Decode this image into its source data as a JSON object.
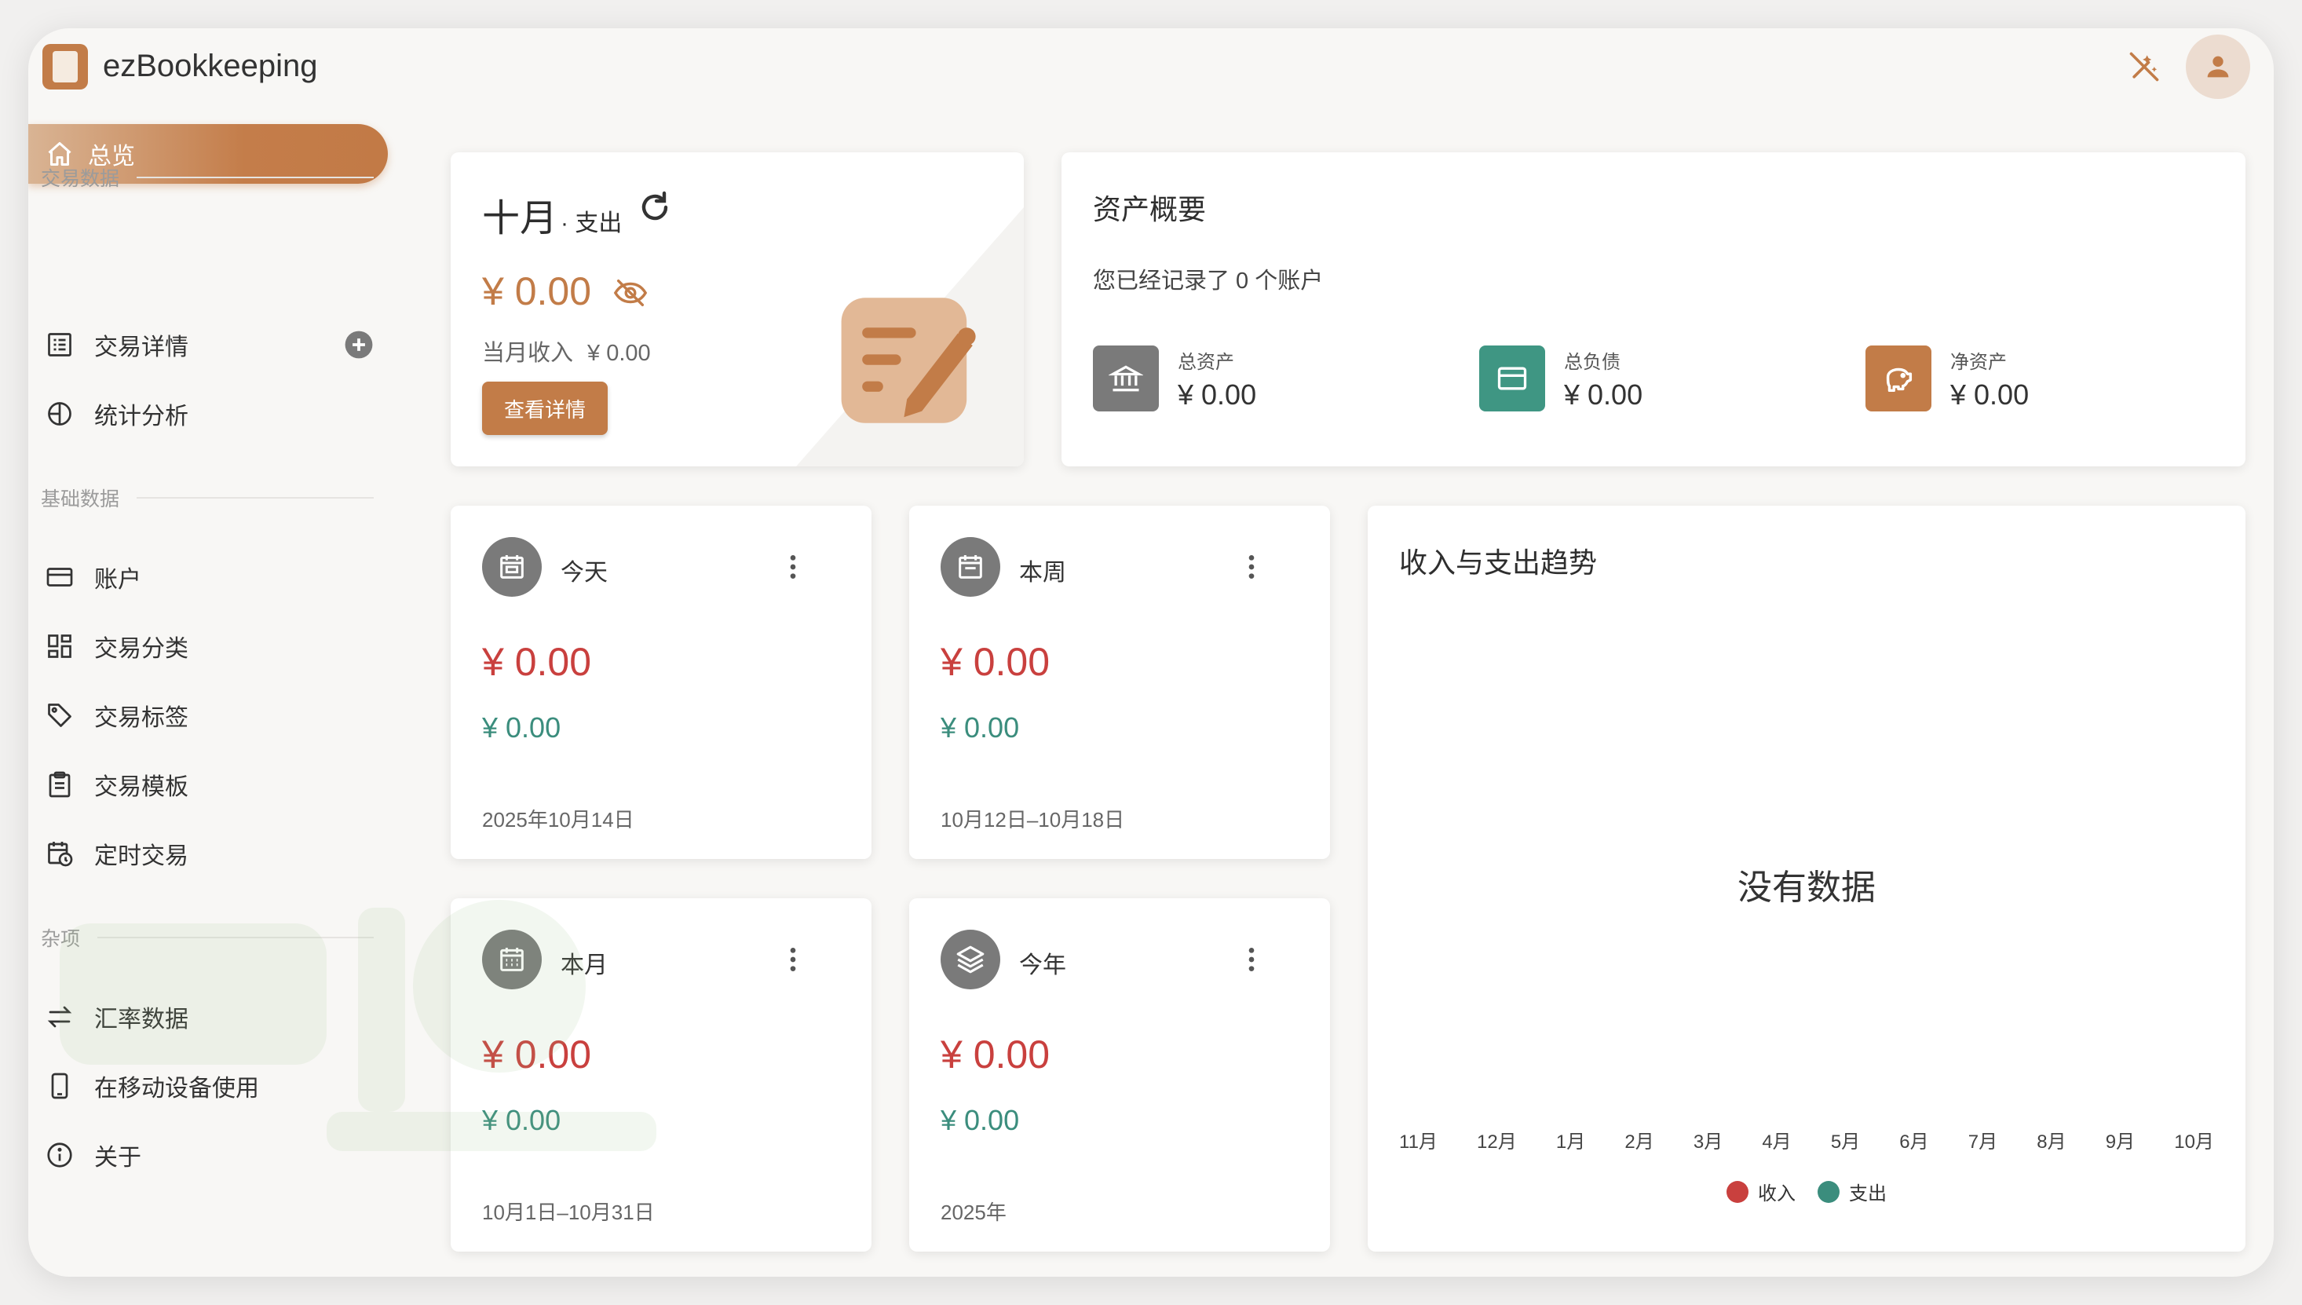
{
  "app": {
    "title": "ezBookkeeping"
  },
  "sidebar": {
    "overview_label": "总览",
    "sections": {
      "transactions": "交易数据",
      "basic": "基础数据",
      "misc": "杂项"
    },
    "items": [
      {
        "label": "交易详情",
        "icon": "list-icon"
      },
      {
        "label": "统计分析",
        "icon": "pie-chart-icon"
      },
      {
        "label": "账户",
        "icon": "credit-card-icon"
      },
      {
        "label": "交易分类",
        "icon": "grid-icon"
      },
      {
        "label": "交易标签",
        "icon": "tag-icon"
      },
      {
        "label": "交易模板",
        "icon": "clipboard-icon"
      },
      {
        "label": "定时交易",
        "icon": "calendar-clock-icon"
      },
      {
        "label": "汇率数据",
        "icon": "swap-icon"
      },
      {
        "label": "在移动设备使用",
        "icon": "phone-icon"
      },
      {
        "label": "关于",
        "icon": "info-icon"
      }
    ]
  },
  "month_card": {
    "month": "十月",
    "type": "· 支出",
    "amount": "¥ 0.00",
    "income_label": "当月收入",
    "income_value": "¥ 0.00",
    "button": "查看详情"
  },
  "assets": {
    "title": "资产概要",
    "subtitle": "您已经记录了 0 个账户",
    "items": [
      {
        "name": "总资产",
        "value": "¥ 0.00",
        "color": "#7a7a7a"
      },
      {
        "name": "总负债",
        "value": "¥ 0.00",
        "color": "#3f9683"
      },
      {
        "name": "净资产",
        "value": "¥ 0.00",
        "color": "#c27c48"
      }
    ]
  },
  "periods": [
    {
      "title": "今天",
      "expense": "¥ 0.00",
      "income": "¥ 0.00",
      "range": "2025年10月14日"
    },
    {
      "title": "本周",
      "expense": "¥ 0.00",
      "income": "¥ 0.00",
      "range": "10月12日–10月18日"
    },
    {
      "title": "本月",
      "expense": "¥ 0.00",
      "income": "¥ 0.00",
      "range": "10月1日–10月31日"
    },
    {
      "title": "今年",
      "expense": "¥ 0.00",
      "income": "¥ 0.00",
      "range": "2025年"
    }
  ],
  "trend": {
    "title": "收入与支出趋势",
    "no_data": "没有数据",
    "months": [
      "11月",
      "12月",
      "1月",
      "2月",
      "3月",
      "4月",
      "5月",
      "6月",
      "7月",
      "8月",
      "9月",
      "10月"
    ],
    "legend": [
      {
        "name": "收入",
        "color": "#c9403e"
      },
      {
        "name": "支出",
        "color": "#3b8d7d"
      }
    ]
  },
  "colors": {
    "accent": "#c27c48",
    "expense": "#c9403e",
    "income": "#3b8d7d"
  }
}
